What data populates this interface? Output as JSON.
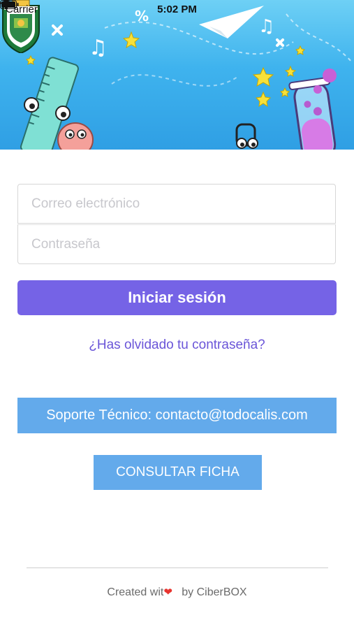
{
  "status_bar": {
    "carrier": "Carrier",
    "time": "5:02 PM"
  },
  "header": {
    "background_color": "#3fb3ee",
    "logo_name": "municipal-crest"
  },
  "login_form": {
    "email_placeholder": "Correo electrónico",
    "password_placeholder": "Contraseña",
    "submit_label": "Iniciar sesión",
    "submit_color": "#7563e6",
    "forgot_password_link": "¿Has olvidado tu contraseña?",
    "link_color": "#6a55d8"
  },
  "support": {
    "label": "Soporte Técnico: contacto@todocalis.com",
    "color": "#63aaeb"
  },
  "consult_button": {
    "label": "CONSULTAR FICHA",
    "color": "#63aaeb"
  },
  "footer": {
    "prefix": "Created wit",
    "heart": "❤",
    "suffix": "by CiberBOX"
  }
}
